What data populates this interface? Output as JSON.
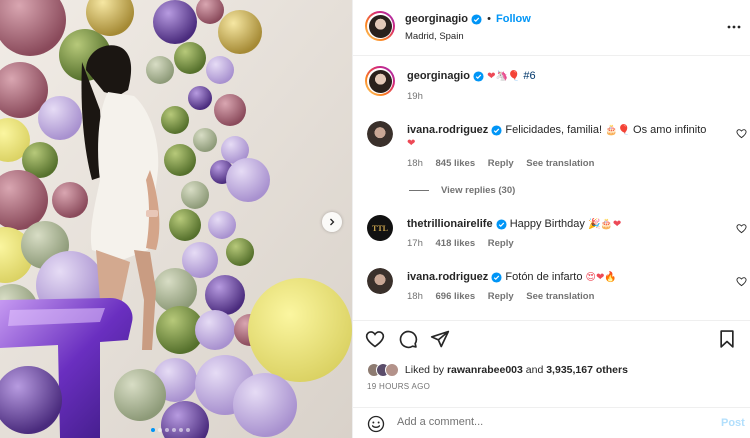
{
  "post": {
    "author": "georginagio",
    "follow_label": "Follow",
    "location": "Madrid, Spain",
    "more_icon": "more-horizontal-icon",
    "dot_separator": "•"
  },
  "caption": {
    "username": "georginagio",
    "text_suffix": "#6",
    "emojis": "❤🦄🎈",
    "age": "19h"
  },
  "comments": [
    {
      "username": "ivana.rodriguez",
      "text": "Felicidades, familia!",
      "emoji_mid": "🎂🎈",
      "text2": "Os amo infinito",
      "emoji_end": "❤",
      "age": "18h",
      "likes": "845 likes",
      "reply": "Reply",
      "translate": "See translation",
      "view_replies": "View replies (30)"
    },
    {
      "username": "thetrillionairelife",
      "text": "Happy Birthday",
      "emoji_end": "🎉🎂❤",
      "age": "17h",
      "likes": "418 likes",
      "reply": "Reply"
    },
    {
      "username": "ivana.rodriguez",
      "text": "Fotón de infarto",
      "emoji_end": "😍❤🔥",
      "age": "18h",
      "likes": "696 likes",
      "reply": "Reply",
      "translate": "See translation"
    }
  ],
  "engagement": {
    "liked_prefix": "Liked by",
    "liked_user": "rawanrabee003",
    "and": "and",
    "others": "3,935,167 others",
    "timestamp": "19 HOURS AGO"
  },
  "composer": {
    "placeholder": "Add a comment...",
    "post_label": "Post"
  },
  "carousel": {
    "slides": 6,
    "active": 1
  },
  "colors": {
    "accent": "#0095f6",
    "like_red": "#ed4956",
    "text": "#262626",
    "muted": "#737373"
  }
}
